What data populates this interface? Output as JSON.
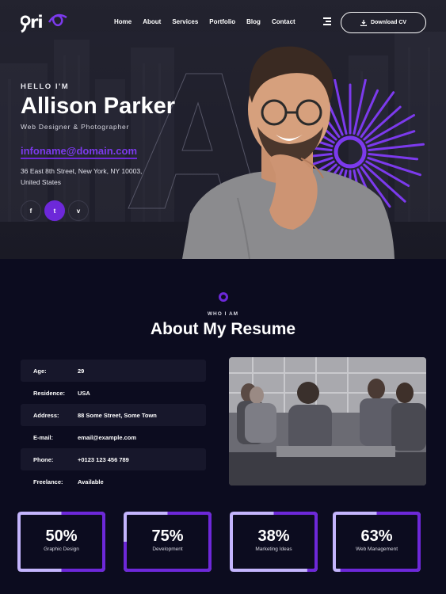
{
  "brand": {
    "logo_text": "ri",
    "logo_icon": "infinity-swirl-logo"
  },
  "nav": {
    "items": [
      "Home",
      "About",
      "Services",
      "Portfolio",
      "Blog",
      "Contact"
    ],
    "menu_icon": "hamburger-menu-icon",
    "download_label": "Download CV",
    "download_icon": "download-icon"
  },
  "hero": {
    "greeting": "HELLO I'M",
    "name": "Allison Parker",
    "role": "Web Designer & Photographer",
    "email": "infoname@domain.com",
    "address_line1": "36 East 8th Street, New York, NY 10003,",
    "address_line2": "United States",
    "social": [
      {
        "icon": "facebook-icon",
        "glyph": "f",
        "active": false
      },
      {
        "icon": "twitter-icon",
        "glyph": "t",
        "active": true
      },
      {
        "icon": "vimeo-icon",
        "glyph": "v",
        "active": false
      }
    ],
    "background_letter": "A"
  },
  "about": {
    "kicker": "WHO I AM",
    "title": "About My Resume",
    "info": [
      {
        "key": "Age:",
        "value": "29"
      },
      {
        "key": "Residence:",
        "value": "USA"
      },
      {
        "key": "Address:",
        "value": "88 Some Street, Some Town"
      },
      {
        "key": "E-mail:",
        "value": "email@example.com"
      },
      {
        "key": "Phone:",
        "value": "+0123 123 456 789"
      },
      {
        "key": "Freelance:",
        "value": "Available"
      }
    ]
  },
  "skills": [
    {
      "percent": "50%",
      "label": "Graphic Design",
      "value": 0.5
    },
    {
      "percent": "75%",
      "label": "Development",
      "value": 0.75
    },
    {
      "percent": "38%",
      "label": "Marketing Ideas",
      "value": 0.38
    },
    {
      "percent": "63%",
      "label": "Web Management",
      "value": 0.63
    }
  ],
  "colors": {
    "accent": "#6d28d9",
    "accent_light": "#c4b5fd",
    "bg": "#0c0c1f",
    "row_alt": "#17172b"
  }
}
